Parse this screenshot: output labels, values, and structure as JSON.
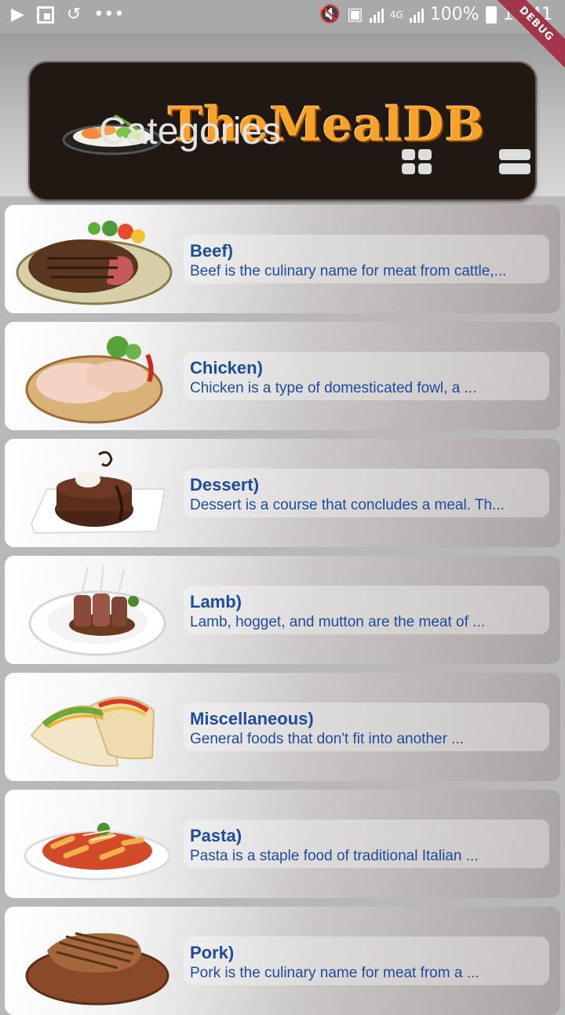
{
  "status_bar": {
    "battery": "100%",
    "time": "11:41",
    "network": "4G",
    "dots": "•••",
    "debug": "DEBUG"
  },
  "header": {
    "logo": "TheMealDB",
    "title": "Categories",
    "grid_icon": "grid-view-icon",
    "list_icon": "list-view-icon"
  },
  "categories": [
    {
      "name": "Beef)",
      "description": "Beef is the culinary name for meat from cattle,..."
    },
    {
      "name": "Chicken)",
      "description": "Chicken is a type of domesticated fowl, a ..."
    },
    {
      "name": "Dessert)",
      "description": "Dessert is a course that concludes a meal. Th..."
    },
    {
      "name": "Lamb)",
      "description": "Lamb, hogget, and mutton are the meat of ..."
    },
    {
      "name": "Miscellaneous)",
      "description": "General foods that don't fit into another ..."
    },
    {
      "name": "Pasta)",
      "description": "Pasta is a staple food of traditional Italian ..."
    },
    {
      "name": "Pork)",
      "description": "Pork is the culinary name for meat from a ..."
    }
  ],
  "colors": {
    "accent_text": "#1f4b9b",
    "banner_bg": "#201812",
    "logo_orange": "#f7a22a",
    "debug_ribbon": "#a3354a"
  }
}
